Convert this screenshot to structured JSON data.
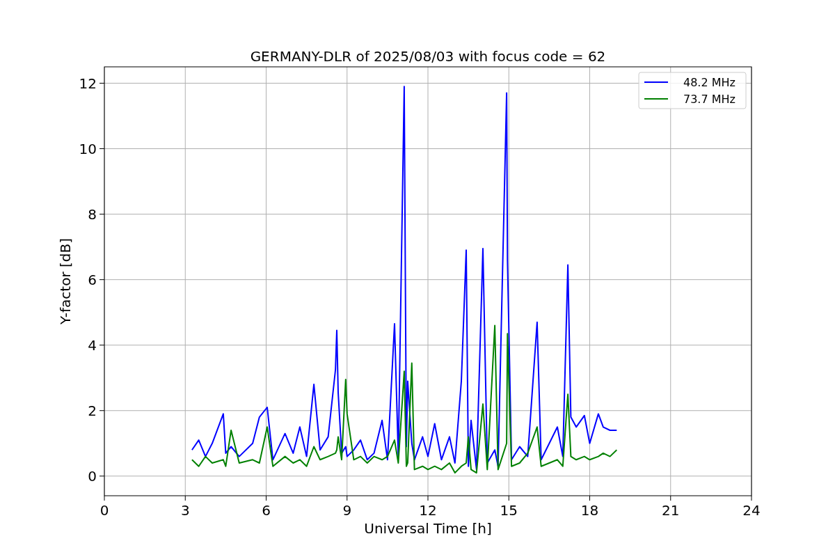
{
  "figure": {
    "chart_data": {
      "type": "line",
      "title": "GERMANY-DLR of 2025/08/03 with focus code = 62",
      "xlabel": "Universal Time [h]",
      "ylabel": "Y-factor [dB]",
      "x": [
        3.25,
        3.5,
        3.75,
        4.0,
        4.41,
        4.5,
        4.7,
        5.0,
        5.5,
        5.75,
        6.04,
        6.25,
        6.7,
        7.0,
        7.25,
        7.5,
        7.77,
        8.0,
        8.3,
        8.57,
        8.62,
        8.67,
        8.8,
        8.95,
        9.0,
        9.25,
        9.5,
        9.75,
        10.0,
        10.3,
        10.5,
        10.76,
        10.9,
        11.12,
        11.2,
        11.25,
        11.4,
        11.5,
        11.8,
        12.0,
        12.25,
        12.5,
        12.8,
        13.0,
        13.24,
        13.42,
        13.5,
        13.6,
        13.8,
        14.04,
        14.2,
        14.48,
        14.6,
        14.92,
        14.95,
        15.1,
        15.4,
        15.7,
        16.05,
        16.2,
        16.5,
        16.8,
        17.0,
        17.19,
        17.3,
        17.5,
        17.8,
        18.0,
        18.32,
        18.5,
        18.75,
        19.0
      ],
      "series": [
        {
          "name": "48.2 MHz",
          "color": "#0000ff",
          "values": [
            0.8,
            1.1,
            0.6,
            1.0,
            1.9,
            0.7,
            0.9,
            0.6,
            1.0,
            1.8,
            2.1,
            0.5,
            1.3,
            0.7,
            1.5,
            0.6,
            2.8,
            0.8,
            1.2,
            3.25,
            4.45,
            2.55,
            0.7,
            0.9,
            0.6,
            0.8,
            1.1,
            0.5,
            0.7,
            1.7,
            0.5,
            4.65,
            0.6,
            11.9,
            0.9,
            2.9,
            1.0,
            0.5,
            1.2,
            0.6,
            1.6,
            0.5,
            1.2,
            0.4,
            2.9,
            6.9,
            0.3,
            1.7,
            0.2,
            6.95,
            0.4,
            0.8,
            0.3,
            11.7,
            6.6,
            0.5,
            0.9,
            0.6,
            4.7,
            0.5,
            1.0,
            1.5,
            0.6,
            6.45,
            1.8,
            1.5,
            1.85,
            1.0,
            1.9,
            1.5,
            1.4,
            1.4
          ]
        },
        {
          "name": "73.7 MHz",
          "color": "#008000",
          "values": [
            0.5,
            0.3,
            0.6,
            0.4,
            0.5,
            0.3,
            1.4,
            0.4,
            0.5,
            0.4,
            1.5,
            0.3,
            0.6,
            0.4,
            0.5,
            0.3,
            0.9,
            0.5,
            0.6,
            0.7,
            0.8,
            1.2,
            0.5,
            2.95,
            1.9,
            0.5,
            0.6,
            0.4,
            0.6,
            0.5,
            0.6,
            1.1,
            0.4,
            3.2,
            0.3,
            0.4,
            3.45,
            0.2,
            0.3,
            0.2,
            0.3,
            0.2,
            0.4,
            0.1,
            0.3,
            0.4,
            1.2,
            0.2,
            0.1,
            2.2,
            0.2,
            4.6,
            0.2,
            1.0,
            4.35,
            0.3,
            0.4,
            0.7,
            1.5,
            0.3,
            0.4,
            0.5,
            0.3,
            2.5,
            0.6,
            0.5,
            0.6,
            0.5,
            0.6,
            0.7,
            0.6,
            0.8
          ]
        }
      ],
      "grid": true,
      "legend": "upper right",
      "xlim": [
        0,
        24
      ],
      "ylim": [
        -0.6,
        12.5
      ],
      "xticks": [
        0,
        3,
        6,
        9,
        12,
        15,
        18,
        21,
        24
      ],
      "yticks": [
        0,
        2,
        4,
        6,
        8,
        10,
        12
      ]
    }
  }
}
